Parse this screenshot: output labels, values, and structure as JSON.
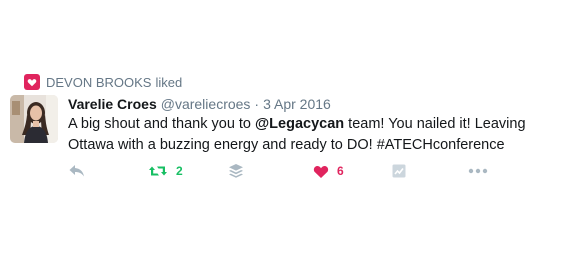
{
  "context": {
    "icon": "heart-icon",
    "name": "DEVON BROOKS",
    "action": "liked",
    "icon_color": "#e0245e"
  },
  "tweet": {
    "avatar": "user-avatar",
    "fullname": "Varelie Croes",
    "username": "@vareliecroes",
    "separator": "·",
    "date": "3 Apr 2016",
    "text_before": "A big shout and thank you to ",
    "mention": "@Legacycan",
    "text_after": " team! You nailed it! Leaving Ottawa with a buzzing energy and ready to DO! #ATECHconference"
  },
  "actions": {
    "reply": {
      "icon": "reply-icon"
    },
    "retweet": {
      "icon": "retweet-icon",
      "count": "2",
      "color": "#17bf63"
    },
    "buffer": {
      "icon": "buffer-stack-icon"
    },
    "like": {
      "icon": "heart-icon",
      "count": "6",
      "color": "#e0245e"
    },
    "analytics": {
      "icon": "analytics-icon"
    },
    "more": {
      "icon": "more-icon"
    }
  },
  "colors": {
    "text": "#14171a",
    "muted": "#657786",
    "icon_gray": "#aab8c2"
  }
}
